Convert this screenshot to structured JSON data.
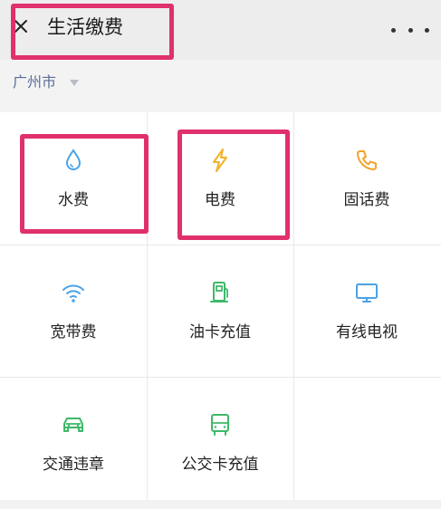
{
  "header": {
    "title": "生活缴费",
    "close_icon": "close-icon",
    "more_icon": "more-icon"
  },
  "city": {
    "name": "广州市",
    "dropdown_icon": "caret-down-icon"
  },
  "services": [
    {
      "label": "水费",
      "icon": "water-drop-icon",
      "color": "#4aa3e8"
    },
    {
      "label": "电费",
      "icon": "lightning-icon",
      "color": "#f2b227"
    },
    {
      "label": "固话费",
      "icon": "phone-icon",
      "color": "#f2a32a"
    },
    {
      "label": "宽带费",
      "icon": "wifi-icon",
      "color": "#4aa3e8"
    },
    {
      "label": "油卡充值",
      "icon": "fuel-pump-icon",
      "color": "#3fb86a"
    },
    {
      "label": "有线电视",
      "icon": "tv-icon",
      "color": "#4aa3e8"
    },
    {
      "label": "交通违章",
      "icon": "car-icon",
      "color": "#3fb86a"
    },
    {
      "label": "公交卡充值",
      "icon": "bus-icon",
      "color": "#3fb86a"
    }
  ],
  "colors": {
    "highlight": "#e0306e",
    "city_link": "#5b6d99"
  }
}
